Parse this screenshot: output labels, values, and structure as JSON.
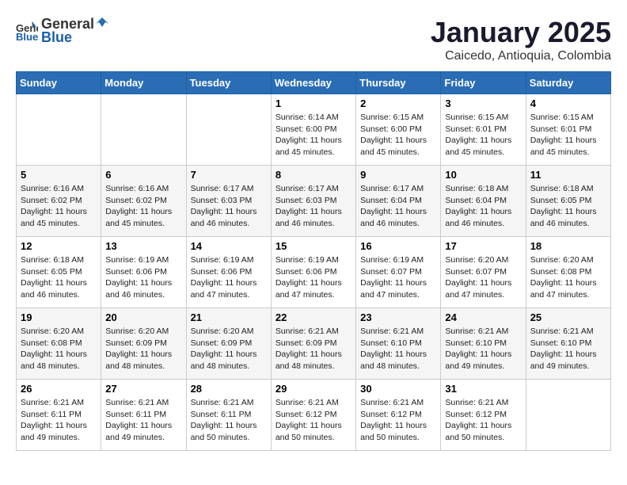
{
  "header": {
    "logo_general": "General",
    "logo_blue": "Blue",
    "month_title": "January 2025",
    "location": "Caicedo, Antioquia, Colombia"
  },
  "days_of_week": [
    "Sunday",
    "Monday",
    "Tuesday",
    "Wednesday",
    "Thursday",
    "Friday",
    "Saturday"
  ],
  "weeks": [
    [
      {
        "day": "",
        "info": ""
      },
      {
        "day": "",
        "info": ""
      },
      {
        "day": "",
        "info": ""
      },
      {
        "day": "1",
        "info": "Sunrise: 6:14 AM\nSunset: 6:00 PM\nDaylight: 11 hours\nand 45 minutes."
      },
      {
        "day": "2",
        "info": "Sunrise: 6:15 AM\nSunset: 6:00 PM\nDaylight: 11 hours\nand 45 minutes."
      },
      {
        "day": "3",
        "info": "Sunrise: 6:15 AM\nSunset: 6:01 PM\nDaylight: 11 hours\nand 45 minutes."
      },
      {
        "day": "4",
        "info": "Sunrise: 6:15 AM\nSunset: 6:01 PM\nDaylight: 11 hours\nand 45 minutes."
      }
    ],
    [
      {
        "day": "5",
        "info": "Sunrise: 6:16 AM\nSunset: 6:02 PM\nDaylight: 11 hours\nand 45 minutes."
      },
      {
        "day": "6",
        "info": "Sunrise: 6:16 AM\nSunset: 6:02 PM\nDaylight: 11 hours\nand 45 minutes."
      },
      {
        "day": "7",
        "info": "Sunrise: 6:17 AM\nSunset: 6:03 PM\nDaylight: 11 hours\nand 46 minutes."
      },
      {
        "day": "8",
        "info": "Sunrise: 6:17 AM\nSunset: 6:03 PM\nDaylight: 11 hours\nand 46 minutes."
      },
      {
        "day": "9",
        "info": "Sunrise: 6:17 AM\nSunset: 6:04 PM\nDaylight: 11 hours\nand 46 minutes."
      },
      {
        "day": "10",
        "info": "Sunrise: 6:18 AM\nSunset: 6:04 PM\nDaylight: 11 hours\nand 46 minutes."
      },
      {
        "day": "11",
        "info": "Sunrise: 6:18 AM\nSunset: 6:05 PM\nDaylight: 11 hours\nand 46 minutes."
      }
    ],
    [
      {
        "day": "12",
        "info": "Sunrise: 6:18 AM\nSunset: 6:05 PM\nDaylight: 11 hours\nand 46 minutes."
      },
      {
        "day": "13",
        "info": "Sunrise: 6:19 AM\nSunset: 6:06 PM\nDaylight: 11 hours\nand 46 minutes."
      },
      {
        "day": "14",
        "info": "Sunrise: 6:19 AM\nSunset: 6:06 PM\nDaylight: 11 hours\nand 47 minutes."
      },
      {
        "day": "15",
        "info": "Sunrise: 6:19 AM\nSunset: 6:06 PM\nDaylight: 11 hours\nand 47 minutes."
      },
      {
        "day": "16",
        "info": "Sunrise: 6:19 AM\nSunset: 6:07 PM\nDaylight: 11 hours\nand 47 minutes."
      },
      {
        "day": "17",
        "info": "Sunrise: 6:20 AM\nSunset: 6:07 PM\nDaylight: 11 hours\nand 47 minutes."
      },
      {
        "day": "18",
        "info": "Sunrise: 6:20 AM\nSunset: 6:08 PM\nDaylight: 11 hours\nand 47 minutes."
      }
    ],
    [
      {
        "day": "19",
        "info": "Sunrise: 6:20 AM\nSunset: 6:08 PM\nDaylight: 11 hours\nand 48 minutes."
      },
      {
        "day": "20",
        "info": "Sunrise: 6:20 AM\nSunset: 6:09 PM\nDaylight: 11 hours\nand 48 minutes."
      },
      {
        "day": "21",
        "info": "Sunrise: 6:20 AM\nSunset: 6:09 PM\nDaylight: 11 hours\nand 48 minutes."
      },
      {
        "day": "22",
        "info": "Sunrise: 6:21 AM\nSunset: 6:09 PM\nDaylight: 11 hours\nand 48 minutes."
      },
      {
        "day": "23",
        "info": "Sunrise: 6:21 AM\nSunset: 6:10 PM\nDaylight: 11 hours\nand 48 minutes."
      },
      {
        "day": "24",
        "info": "Sunrise: 6:21 AM\nSunset: 6:10 PM\nDaylight: 11 hours\nand 49 minutes."
      },
      {
        "day": "25",
        "info": "Sunrise: 6:21 AM\nSunset: 6:10 PM\nDaylight: 11 hours\nand 49 minutes."
      }
    ],
    [
      {
        "day": "26",
        "info": "Sunrise: 6:21 AM\nSunset: 6:11 PM\nDaylight: 11 hours\nand 49 minutes."
      },
      {
        "day": "27",
        "info": "Sunrise: 6:21 AM\nSunset: 6:11 PM\nDaylight: 11 hours\nand 49 minutes."
      },
      {
        "day": "28",
        "info": "Sunrise: 6:21 AM\nSunset: 6:11 PM\nDaylight: 11 hours\nand 50 minutes."
      },
      {
        "day": "29",
        "info": "Sunrise: 6:21 AM\nSunset: 6:12 PM\nDaylight: 11 hours\nand 50 minutes."
      },
      {
        "day": "30",
        "info": "Sunrise: 6:21 AM\nSunset: 6:12 PM\nDaylight: 11 hours\nand 50 minutes."
      },
      {
        "day": "31",
        "info": "Sunrise: 6:21 AM\nSunset: 6:12 PM\nDaylight: 11 hours\nand 50 minutes."
      },
      {
        "day": "",
        "info": ""
      }
    ]
  ]
}
